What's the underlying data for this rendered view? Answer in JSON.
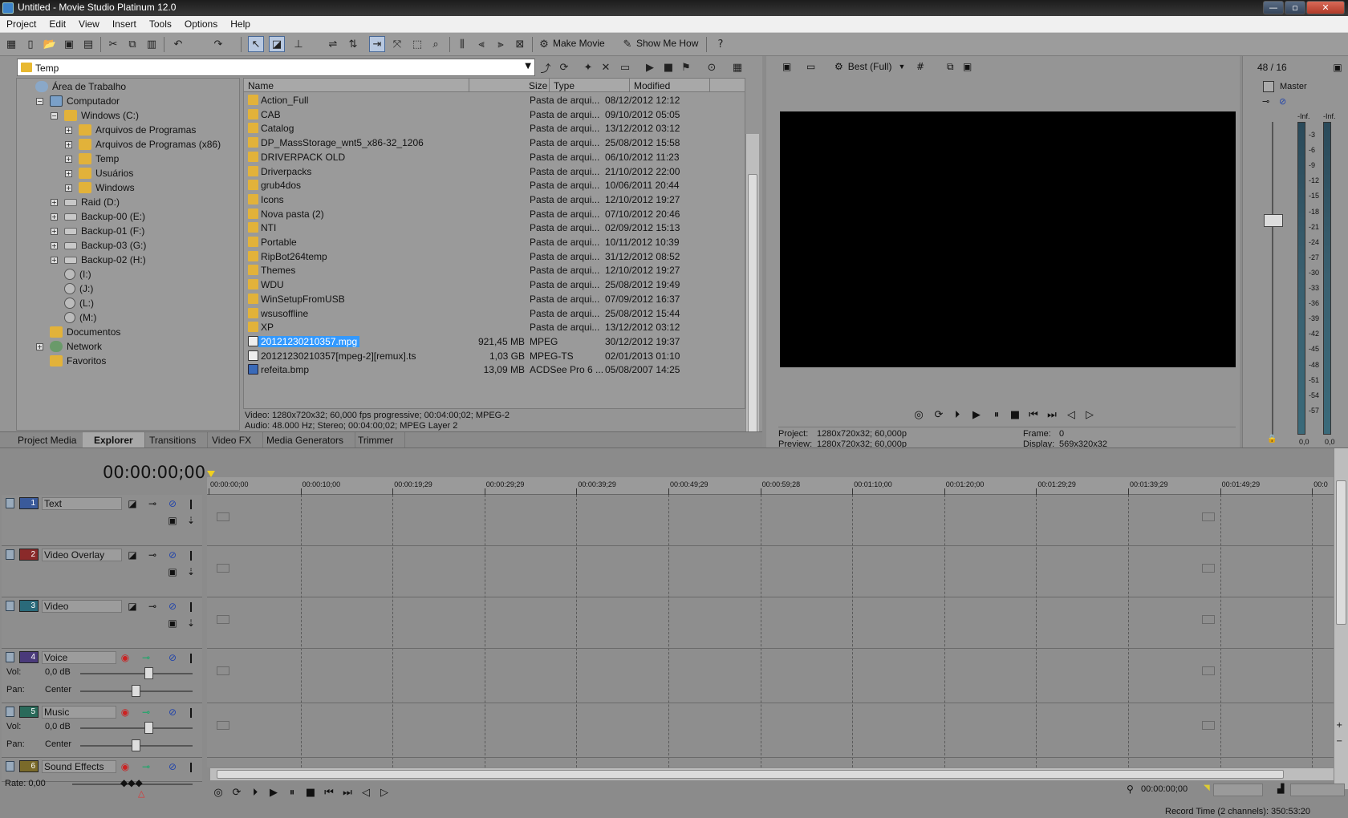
{
  "window": {
    "title": "Untitled - Movie Studio Platinum 12.0",
    "controls": [
      "minimize-icon",
      "maximize-icon",
      "close-icon"
    ]
  },
  "menu": [
    "Project",
    "Edit",
    "View",
    "Insert",
    "Tools",
    "Options",
    "Help"
  ],
  "toolbar": {
    "make_movie": "Make Movie",
    "show_me_how": "Show Me How"
  },
  "explorer": {
    "address": "Temp",
    "tree": [
      {
        "label": "Área de Trabalho",
        "level": 0,
        "icon": "desk"
      },
      {
        "label": "Computador",
        "level": 1,
        "icon": "pc",
        "exp": "−"
      },
      {
        "label": "Windows (C:)",
        "level": 2,
        "icon": "folder",
        "exp": "−"
      },
      {
        "label": "Arquivos de Programas",
        "level": 3,
        "icon": "folder",
        "exp": "+"
      },
      {
        "label": "Arquivos de Programas (x86)",
        "level": 3,
        "icon": "folder",
        "exp": "+"
      },
      {
        "label": "Temp",
        "level": 3,
        "icon": "folder",
        "exp": "+"
      },
      {
        "label": "Usuários",
        "level": 3,
        "icon": "folder",
        "exp": "+"
      },
      {
        "label": "Windows",
        "level": 3,
        "icon": "folder",
        "exp": "+"
      },
      {
        "label": "Raid (D:)",
        "level": 2,
        "icon": "drive",
        "exp": "+"
      },
      {
        "label": "Backup-00 (E:)",
        "level": 2,
        "icon": "drive",
        "exp": "+"
      },
      {
        "label": "Backup-01 (F:)",
        "level": 2,
        "icon": "drive",
        "exp": "+"
      },
      {
        "label": "Backup-03 (G:)",
        "level": 2,
        "icon": "drive",
        "exp": "+"
      },
      {
        "label": "Backup-02 (H:)",
        "level": 2,
        "icon": "drive",
        "exp": "+"
      },
      {
        "label": "(I:)",
        "level": 2,
        "icon": "disc"
      },
      {
        "label": "(J:)",
        "level": 2,
        "icon": "disc"
      },
      {
        "label": "(L:)",
        "level": 2,
        "icon": "disc"
      },
      {
        "label": "(M:)",
        "level": 2,
        "icon": "disc"
      },
      {
        "label": "Documentos",
        "level": 1,
        "icon": "folder"
      },
      {
        "label": "Network",
        "level": 1,
        "icon": "net",
        "exp": "+"
      },
      {
        "label": "Favoritos",
        "level": 1,
        "icon": "folder"
      }
    ],
    "columns": {
      "name": "Name",
      "size": "Size",
      "type": "Type",
      "modified": "Modified"
    },
    "files": [
      {
        "name": "Action_Full",
        "size": "",
        "type": "Pasta de arqui...",
        "modified": "08/12/2012 12:12",
        "kind": "folder"
      },
      {
        "name": "CAB",
        "size": "",
        "type": "Pasta de arqui...",
        "modified": "09/10/2012 05:05",
        "kind": "folder"
      },
      {
        "name": "Catalog",
        "size": "",
        "type": "Pasta de arqui...",
        "modified": "13/12/2012 03:12",
        "kind": "folder"
      },
      {
        "name": "DP_MassStorage_wnt5_x86-32_1206",
        "size": "",
        "type": "Pasta de arqui...",
        "modified": "25/08/2012 15:58",
        "kind": "folder"
      },
      {
        "name": "DRIVERPACK OLD",
        "size": "",
        "type": "Pasta de arqui...",
        "modified": "06/10/2012 11:23",
        "kind": "folder"
      },
      {
        "name": "Driverpacks",
        "size": "",
        "type": "Pasta de arqui...",
        "modified": "21/10/2012 22:00",
        "kind": "folder"
      },
      {
        "name": "grub4dos",
        "size": "",
        "type": "Pasta de arqui...",
        "modified": "10/06/2011 20:44",
        "kind": "folder"
      },
      {
        "name": "Icons",
        "size": "",
        "type": "Pasta de arqui...",
        "modified": "12/10/2012 19:27",
        "kind": "folder"
      },
      {
        "name": "Nova pasta (2)",
        "size": "",
        "type": "Pasta de arqui...",
        "modified": "07/10/2012 20:46",
        "kind": "folder"
      },
      {
        "name": "NTI",
        "size": "",
        "type": "Pasta de arqui...",
        "modified": "02/09/2012 15:13",
        "kind": "folder"
      },
      {
        "name": "Portable",
        "size": "",
        "type": "Pasta de arqui...",
        "modified": "10/11/2012 10:39",
        "kind": "folder"
      },
      {
        "name": "RipBot264temp",
        "size": "",
        "type": "Pasta de arqui...",
        "modified": "31/12/2012 08:52",
        "kind": "folder"
      },
      {
        "name": "Themes",
        "size": "",
        "type": "Pasta de arqui...",
        "modified": "12/10/2012 19:27",
        "kind": "folder"
      },
      {
        "name": "WDU",
        "size": "",
        "type": "Pasta de arqui...",
        "modified": "25/08/2012 19:49",
        "kind": "folder"
      },
      {
        "name": "WinSetupFromUSB",
        "size": "",
        "type": "Pasta de arqui...",
        "modified": "07/09/2012 16:37",
        "kind": "folder"
      },
      {
        "name": "wsusoffline",
        "size": "",
        "type": "Pasta de arqui...",
        "modified": "25/08/2012 15:44",
        "kind": "folder"
      },
      {
        "name": "XP",
        "size": "",
        "type": "Pasta de arqui...",
        "modified": "13/12/2012 03:12",
        "kind": "folder"
      },
      {
        "name": "20121230210357.mpg",
        "size": "921,45 MB",
        "type": "MPEG",
        "modified": "30/12/2012 19:37",
        "kind": "vid",
        "selected": true
      },
      {
        "name": "20121230210357[mpeg-2][remux].ts",
        "size": "1,03 GB",
        "type": "MPEG-TS",
        "modified": "02/01/2013 01:10",
        "kind": "vid"
      },
      {
        "name": "refeita.bmp",
        "size": "13,09 MB",
        "type": "ACDSee Pro 6 ...",
        "modified": "05/08/2007 14:25",
        "kind": "img"
      }
    ],
    "info_video": "Video: 1280x720x32; 60,000 fps progressive; 00:04:00;02; MPEG-2",
    "info_audio": "Audio: 48.000 Hz; Stereo; 00:04:00;02; MPEG Layer 2",
    "tabs": [
      "Project Media",
      "Explorer",
      "Transitions",
      "Video FX",
      "Media Generators",
      "Trimmer"
    ],
    "active_tab": "Explorer"
  },
  "preview": {
    "quality": "Best (Full)",
    "project_label": "Project:",
    "project_value": "1280x720x32; 60,000p",
    "preview_label": "Preview:",
    "preview_value": "1280x720x32; 60,000p",
    "frame_label": "Frame:",
    "frame_value": "0",
    "display_label": "Display:",
    "display_value": "569x320x32"
  },
  "mixer": {
    "rate": "48 / 16",
    "master": "Master",
    "inf_left": "-Inf.",
    "inf_right": "-Inf.",
    "scale": [
      "3",
      "6",
      "9",
      "12",
      "15",
      "18",
      "21",
      "24",
      "27",
      "30",
      "33",
      "36",
      "39",
      "42",
      "45",
      "48",
      "51",
      "54",
      "57"
    ],
    "bottom_left": "0,0",
    "bottom_right": "0,0"
  },
  "timeline": {
    "timecode": "00:00:00;00",
    "ruler": [
      "00:00:00;00",
      "00:00:10;00",
      "00:00:19;29",
      "00:00:29;29",
      "00:00:39;29",
      "00:00:49;29",
      "00:00:59;28",
      "00:01:10;00",
      "00:01:20;00",
      "00:01:29;29",
      "00:01:39;29",
      "00:01:49;29",
      "00:0"
    ],
    "tracks": [
      {
        "num": "1",
        "name": "Text",
        "kind": "video",
        "color": "#3a5a9a"
      },
      {
        "num": "2",
        "name": "Video Overlay",
        "kind": "video",
        "color": "#8a2a2a"
      },
      {
        "num": "3",
        "name": "Video",
        "kind": "video",
        "color": "#2a6a7a"
      },
      {
        "num": "4",
        "name": "Voice",
        "kind": "audio",
        "color": "#4a3a7a",
        "vol": "0,0 dB",
        "pan": "Center"
      },
      {
        "num": "5",
        "name": "Music",
        "kind": "audio",
        "color": "#2a6a5a",
        "vol": "0,0 dB",
        "pan": "Center"
      },
      {
        "num": "6",
        "name": "Sound Effects",
        "kind": "audio",
        "color": "#7a6a2a"
      }
    ],
    "vol_label": "Vol:",
    "pan_label": "Pan:",
    "rate": "Rate: 0,00",
    "end_timecode": "00:00:00;00",
    "record_time": "Record Time (2 channels): 350:53:20"
  }
}
